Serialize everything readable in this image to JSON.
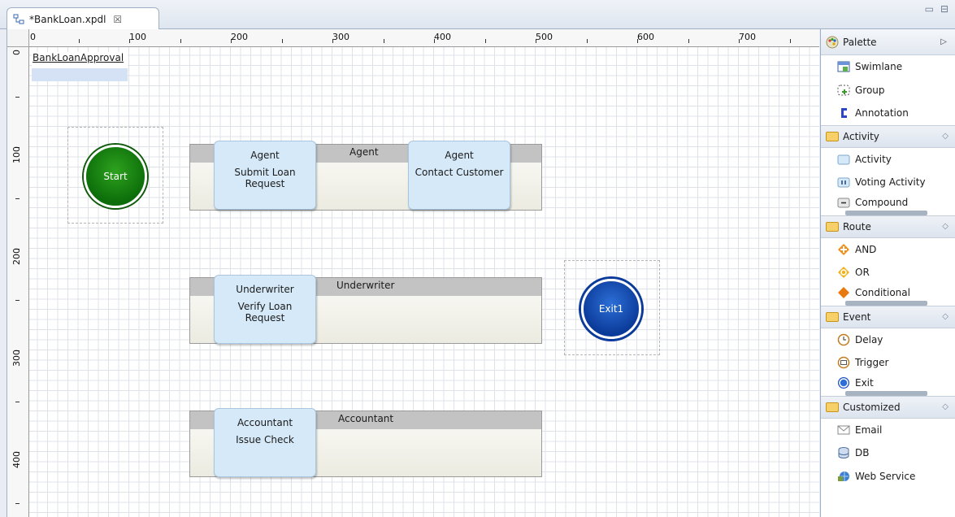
{
  "editor_tab": {
    "title": "*BankLoan.xpdl",
    "close": "☒"
  },
  "window_controls": {
    "minimize": "▭",
    "maximize": "⊟"
  },
  "ruler": {
    "top_labels": [
      "100",
      "200",
      "300",
      "400",
      "500",
      "600",
      "700"
    ],
    "top_zero": "0",
    "left_labels": [
      "0",
      "100",
      "200",
      "300",
      "400"
    ]
  },
  "process": {
    "name": "BankLoanApproval"
  },
  "events": {
    "start_label": "Start",
    "exit_label": "Exit1"
  },
  "lanes": [
    {
      "title": "Agent"
    },
    {
      "title": "Underwriter"
    },
    {
      "title": "Accountant"
    }
  ],
  "activities": [
    {
      "performer": "Agent",
      "name": "Submit Loan Request"
    },
    {
      "performer": "Agent",
      "name": "Contact Customer"
    },
    {
      "performer": "Underwriter",
      "name": "Verify Loan Request"
    },
    {
      "performer": "Accountant",
      "name": "Issue Check"
    }
  ],
  "palette": {
    "title": "Palette",
    "general": [
      "Swimlane",
      "Group",
      "Annotation"
    ],
    "drawers": [
      {
        "label": "Activity",
        "items": [
          "Activity",
          "Voting Activity",
          "Compound"
        ]
      },
      {
        "label": "Route",
        "items": [
          "AND",
          "OR",
          "Conditional"
        ]
      },
      {
        "label": "Event",
        "items": [
          "Delay",
          "Trigger",
          "Exit"
        ]
      },
      {
        "label": "Customized",
        "items": [
          "Email",
          "DB",
          "Web Service"
        ]
      }
    ]
  }
}
